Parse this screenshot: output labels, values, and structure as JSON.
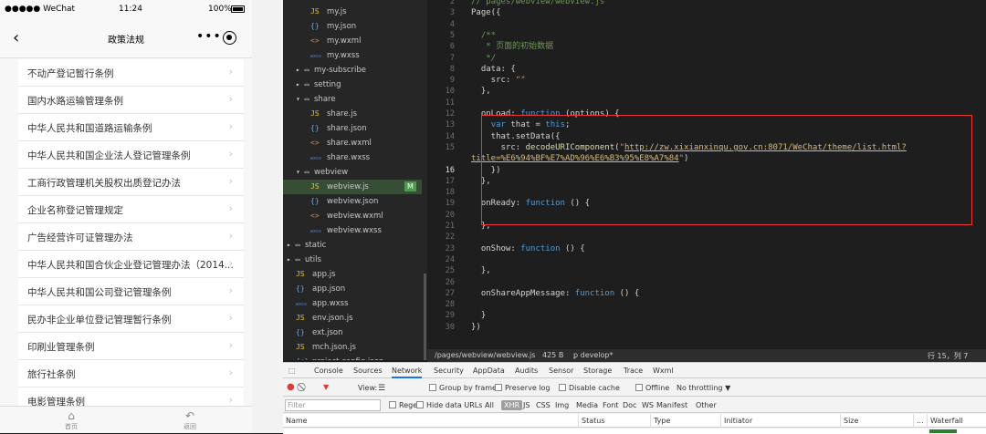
{
  "phone": {
    "status": {
      "carrier": "●●●●● WeChat",
      "time": "11:24",
      "battery": "100%"
    },
    "nav": {
      "back": "‹",
      "title": "政策法规",
      "dots": "•••"
    },
    "items": [
      "不动产登记暂行条例",
      "国内水路运输管理条例",
      "中华人民共和国道路运输条例",
      "中华人民共和国企业法人登记管理条例",
      "工商行政管理机关股权出质登记办法",
      "企业名称登记管理规定",
      "广告经营许可证管理办法",
      "中华人民共和国合伙企业登记管理办法（2014...",
      "中华人民共和国公司登记管理条例",
      "民办非企业单位登记管理暂行条例",
      "印刷业管理条例",
      "旅行社条例",
      "电影管理条例"
    ],
    "arrow": "›",
    "tabs": [
      {
        "icon": "⌂",
        "label": "首页"
      },
      {
        "icon": "↶",
        "label": "返回"
      }
    ]
  },
  "filetree": [
    {
      "icon": "JS",
      "label": "my.js",
      "depth": 2,
      "kind": "js"
    },
    {
      "icon": "{}",
      "label": "my.json",
      "depth": 2,
      "kind": "json"
    },
    {
      "icon": "<>",
      "label": "my.wxml",
      "depth": 2,
      "kind": "wxml"
    },
    {
      "icon": "wxss",
      "label": "my.wxss",
      "depth": 2,
      "kind": "wxss"
    },
    {
      "icon": "▸ ▭",
      "label": "my-subscribe",
      "depth": 1,
      "kind": "dir"
    },
    {
      "icon": "▸ ▭",
      "label": "setting",
      "depth": 1,
      "kind": "dir"
    },
    {
      "icon": "▾ ▭",
      "label": "share",
      "depth": 1,
      "kind": "dir"
    },
    {
      "icon": "JS",
      "label": "share.js",
      "depth": 2,
      "kind": "js"
    },
    {
      "icon": "{}",
      "label": "share.json",
      "depth": 2,
      "kind": "json"
    },
    {
      "icon": "<>",
      "label": "share.wxml",
      "depth": 2,
      "kind": "wxml"
    },
    {
      "icon": "wxss",
      "label": "share.wxss",
      "depth": 2,
      "kind": "wxss"
    },
    {
      "icon": "▾ ▭",
      "label": "webview",
      "depth": 1,
      "kind": "dir"
    },
    {
      "icon": "JS",
      "label": "webview.js",
      "depth": 2,
      "kind": "js",
      "active": true,
      "badge": "M"
    },
    {
      "icon": "{}",
      "label": "webview.json",
      "depth": 2,
      "kind": "json"
    },
    {
      "icon": "<>",
      "label": "webview.wxml",
      "depth": 2,
      "kind": "wxml"
    },
    {
      "icon": "wxss",
      "label": "webview.wxss",
      "depth": 2,
      "kind": "wxss"
    },
    {
      "icon": "▸ ▭",
      "label": "static",
      "depth": 0,
      "kind": "dir"
    },
    {
      "icon": "▸ ▭",
      "label": "utils",
      "depth": 0,
      "kind": "dir"
    },
    {
      "icon": "JS",
      "label": "app.js",
      "depth": 1,
      "kind": "js"
    },
    {
      "icon": "{}",
      "label": "app.json",
      "depth": 1,
      "kind": "json"
    },
    {
      "icon": "wxss",
      "label": "app.wxss",
      "depth": 1,
      "kind": "wxss"
    },
    {
      "icon": "JS",
      "label": "env.json.js",
      "depth": 1,
      "kind": "js"
    },
    {
      "icon": "{}",
      "label": "ext.json",
      "depth": 1,
      "kind": "json"
    },
    {
      "icon": "JS",
      "label": "mch.json.js",
      "depth": 1,
      "kind": "js"
    },
    {
      "icon": "{o}",
      "label": "project.config.json",
      "depth": 1,
      "kind": "json"
    }
  ],
  "editor": {
    "lines": [
      {
        "n": "2",
        "h": "<span class=\"cm\">// pages/webview/webview.js</span>"
      },
      {
        "n": "3",
        "h": "Page({"
      },
      {
        "n": "4",
        "h": ""
      },
      {
        "n": "5",
        "h": "  <span class=\"cm\">/**</span>"
      },
      {
        "n": "6",
        "h": "  <span class=\"cm\"> * 页面的初始数据</span>"
      },
      {
        "n": "7",
        "h": "  <span class=\"cm\"> */</span>"
      },
      {
        "n": "8",
        "h": "  data: {"
      },
      {
        "n": "9",
        "h": "    src: <span class=\"str\">\"\"</span>"
      },
      {
        "n": "10",
        "h": "  },"
      },
      {
        "n": "11",
        "h": ""
      },
      {
        "n": "12",
        "h": "  onLoad: <span class=\"kw\">function</span> (options) {"
      },
      {
        "n": "13",
        "h": "    <span class=\"kw\">var</span> that = <span class=\"kw\">this</span>;"
      },
      {
        "n": "14",
        "h": "    that.setData({"
      },
      {
        "n": "15",
        "h": "      src: <span class=\"fn\">decodeURIComponent</span>(<span class=\"str\">\"<span class=\"url\">http://zw.xixianxinqu.gov.cn:8071/WeChat/theme/list.html?</span></span>"
      },
      {
        "n": "",
        "h": "<span class=\"str\"><span class=\"url\">title=%E6%94%BF%E7%AD%96%E6%B3%95%E8%A7%84</span>\"</span>)"
      },
      {
        "n": "16",
        "h": "    })",
        "cur": true
      },
      {
        "n": "17",
        "h": "  },"
      },
      {
        "n": "18",
        "h": ""
      },
      {
        "n": "19",
        "h": "  onReady: <span class=\"kw\">function</span> () {"
      },
      {
        "n": "20",
        "h": ""
      },
      {
        "n": "21",
        "h": "  },"
      },
      {
        "n": "22",
        "h": ""
      },
      {
        "n": "23",
        "h": "  onShow: <span class=\"kw\">function</span> () {"
      },
      {
        "n": "24",
        "h": ""
      },
      {
        "n": "25",
        "h": "  },"
      },
      {
        "n": "26",
        "h": ""
      },
      {
        "n": "27",
        "h": "  onShareAppMessage: <span class=\"kw\">function</span> () {"
      },
      {
        "n": "28",
        "h": ""
      },
      {
        "n": "29",
        "h": "  }"
      },
      {
        "n": "30",
        "h": "})"
      }
    ],
    "status": {
      "path": "/pages/webview/webview.js",
      "size": "425 B",
      "branch": "ꝑ develop*",
      "pos": "行 15，列 7"
    }
  },
  "devtools": {
    "tabs": [
      "Console",
      "Sources",
      "Network",
      "Security",
      "AppData",
      "Audits",
      "Sensor",
      "Storage",
      "Trace",
      "Wxml"
    ],
    "active_tab": "Network",
    "toolbar": {
      "view": "View:",
      "group": "Group by frame",
      "preserve": "Preserve log",
      "disable": "Disable cache",
      "offline": "Offline",
      "throttle": "No throttling",
      "arrow": "▼"
    },
    "filter": {
      "placeholder": "Filter",
      "regex": "Regex",
      "hide": "Hide data URLs",
      "types": [
        "All",
        "XHR",
        "JS",
        "CSS",
        "Img",
        "Media",
        "Font",
        "Doc",
        "WS",
        "Manifest",
        "Other"
      ]
    },
    "columns": [
      "Name",
      "Status",
      "Type",
      "Initiator",
      "Size",
      "...",
      "Waterfall"
    ]
  },
  "colors": {
    "editor_bg": "#1e1e1e",
    "highlight_border": "#e53935",
    "active_file_bg": "#364d36",
    "badge_green": "#4a9c4a"
  }
}
